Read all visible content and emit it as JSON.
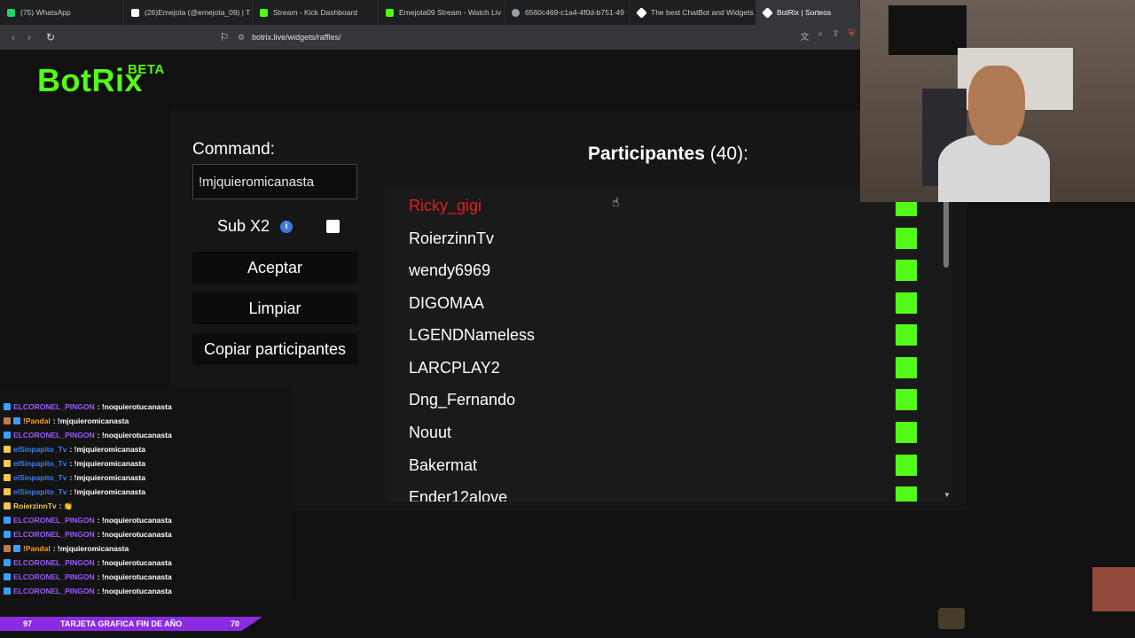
{
  "tabs": [
    {
      "label": "(75) WhatsApp",
      "color": "#25d366"
    },
    {
      "label": "(26)Emejota (@emejota_09) | T",
      "color": "#ffffff"
    },
    {
      "label": "Stream - Kick Dashboard",
      "color": "#53fc18"
    },
    {
      "label": "Emejota09 Stream - Watch Liv",
      "color": "#53fc18"
    },
    {
      "label": "6560c469-c1a4-4f0d-b751-49",
      "color": "#9aa0a6"
    },
    {
      "label": "The best ChatBot and Widgets",
      "color": "#ffffff"
    },
    {
      "label": "BotRix | Sorteos",
      "color": "#ffffff"
    }
  ],
  "address": {
    "url": "botrix.live/widgets/raffles/"
  },
  "brand": {
    "name": "BotRix",
    "tag": "BETA"
  },
  "form": {
    "command_label": "Command:",
    "command_value": "!mjquieromicanasta",
    "sub_label": "Sub X2",
    "info_icon": "info-icon",
    "accept_label": "Aceptar",
    "clear_label": "Limpiar",
    "copy_label": "Copiar participantes"
  },
  "participants": {
    "title": "Participantes",
    "count": "(40):",
    "items": [
      {
        "name": "Ricky_gigi",
        "winner": true
      },
      {
        "name": "RoierzinnTv"
      },
      {
        "name": "wendy6969"
      },
      {
        "name": "DIGOMAA"
      },
      {
        "name": "LGENDNameless"
      },
      {
        "name": "LARCPLAY2"
      },
      {
        "name": "Dng_Fernando"
      },
      {
        "name": "Nouut"
      },
      {
        "name": "Bakermat"
      },
      {
        "name": "Ender12alove"
      }
    ]
  },
  "chat": [
    {
      "user": "ELCORONEL_PINGON",
      "msg": ": !noquierotucanasta",
      "color": "#9b59ff"
    },
    {
      "user": "!Pandal",
      "msg": ": !mjquieromicanasta",
      "color": "#ff9f1a"
    },
    {
      "user": "ELCORONEL_PINGON",
      "msg": ": !noquierotucanasta",
      "color": "#9b59ff"
    },
    {
      "user": "elSinpapito_Tv",
      "msg": ": !mjquieromicanasta",
      "color": "#3d7ee6"
    },
    {
      "user": "elSinpapito_Tv",
      "msg": ": !mjquieromicanasta",
      "color": "#3d7ee6"
    },
    {
      "user": "elSinpapito_Tv",
      "msg": ": !mjquieromicanasta",
      "color": "#3d7ee6"
    },
    {
      "user": "elSinpapito_Tv",
      "msg": ": !mjquieromicanasta",
      "color": "#3d7ee6"
    },
    {
      "user": "RoierzinnTv",
      "msg": ": 👏",
      "color": "#f2c94c"
    },
    {
      "user": "ELCORONEL_PINGON",
      "msg": ": !noquierotucanasta",
      "color": "#9b59ff"
    },
    {
      "user": "ELCORONEL_PINGON",
      "msg": ": !noquierotucanasta",
      "color": "#9b59ff"
    },
    {
      "user": "!Pandal",
      "msg": ": !mjquieromicanasta",
      "color": "#ff9f1a"
    },
    {
      "user": "ELCORONEL_PINGON",
      "msg": ": !noquierotucanasta",
      "color": "#9b59ff"
    },
    {
      "user": "ELCORONEL_PINGON",
      "msg": ": !noquierotucanasta",
      "color": "#9b59ff"
    },
    {
      "user": "ELCORONEL_PINGON",
      "msg": ": !noquierotucanasta",
      "color": "#9b59ff"
    }
  ],
  "ticker": {
    "left": "97",
    "text": "TARJETA GRAFICA FIN DE AÑO",
    "right": "70"
  },
  "colors": {
    "kick_green": "#53fc18",
    "winner_red": "#e31c2a"
  }
}
